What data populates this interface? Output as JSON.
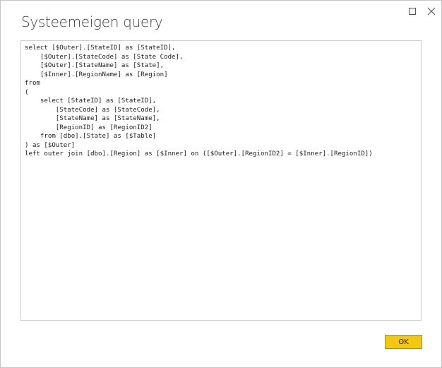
{
  "dialog": {
    "title": "Systeemeigen query",
    "controls": {
      "maximize_icon": "maximize-icon",
      "close_icon": "close-icon"
    },
    "query_text": "select [$Outer].[StateID] as [StateID],\n    [$Outer].[StateCode] as [State Code],\n    [$Outer].[StateName] as [State],\n    [$Inner].[RegionName] as [Region]\nfrom\n(\n    select [StateID] as [StateID],\n        [StateCode] as [StateCode],\n        [StateName] as [StateName],\n        [RegionID] as [RegionID2]\n    from [dbo].[State] as [$Table]\n) as [$Outer]\nleft outer join [dbo].[Region] as [$Inner] on ([$Outer].[RegionID2] = [$Inner].[RegionID])",
    "ok_label": "OK",
    "accent_color": "#f2c811"
  }
}
